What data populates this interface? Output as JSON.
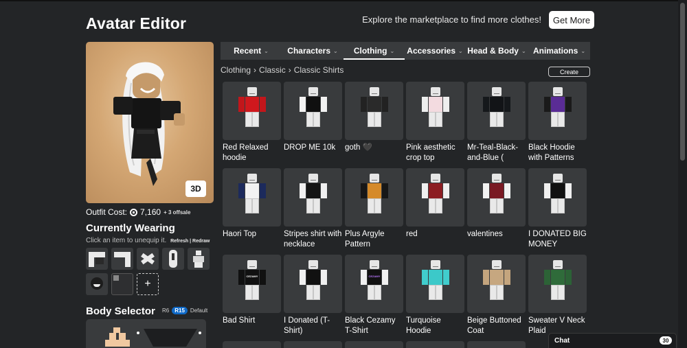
{
  "header": {
    "title": "Avatar Editor",
    "promo_text": "Explore the marketplace to find more clothes!",
    "get_more_label": "Get More"
  },
  "preview": {
    "toggle_3d_label": "3D"
  },
  "outfit": {
    "label": "Outfit Cost:",
    "cost": "7,160",
    "offsale": "+ 3 offsale"
  },
  "currently_wearing": {
    "title": "Currently Wearing",
    "hint": "Click an item to unequip it.",
    "refresh_label": "Refresh",
    "separator": "|",
    "redraw_label": "Redraw",
    "add_label": "+"
  },
  "body_selector": {
    "title": "Body Selector",
    "r6_label": "R6",
    "r15_label": "R15",
    "default_label": "Default"
  },
  "tabs": [
    {
      "label": "Recent",
      "active": false
    },
    {
      "label": "Characters",
      "active": false
    },
    {
      "label": "Clothing",
      "active": true
    },
    {
      "label": "Accessories",
      "active": false
    },
    {
      "label": "Head & Body",
      "active": false
    },
    {
      "label": "Animations",
      "active": false
    }
  ],
  "breadcrumb": [
    "Clothing",
    "Classic",
    "Classic Shirts"
  ],
  "create_label": "Create",
  "items": [
    {
      "name": "Red Relaxed hoodie",
      "torso": "#d0181d",
      "arm": "#c2161b",
      "print": "",
      "print_color": "#fff"
    },
    {
      "name": "DROP ME 10k",
      "torso": "#101010",
      "arm": "#f2f2f2",
      "print": "",
      "print_color": "#fff"
    },
    {
      "name": "goth 🖤",
      "torso": "#2a2a2a",
      "arm": "#222222",
      "print": "",
      "print_color": "#fff"
    },
    {
      "name": "Pink aesthetic crop top",
      "torso": "#f3dbe0",
      "arm": "#eeeeee",
      "print": "",
      "print_color": "#c88"
    },
    {
      "name": "Mr-Teal-Black-and-Blue (",
      "torso": "#121417",
      "arm": "#15181b",
      "print": "",
      "print_color": "#3cd"
    },
    {
      "name": "Black Hoodie with Patterns",
      "torso": "#5a2c95",
      "arm": "#1a1a1a",
      "print": "",
      "print_color": "#fff"
    },
    {
      "name": "Haori Top",
      "torso": "#f2f2f2",
      "arm": "#1c2a5c",
      "print": "",
      "print_color": "#fff"
    },
    {
      "name": "Stripes shirt with necklace",
      "torso": "#151515",
      "arm": "#f0f0f0",
      "print": "",
      "print_color": "#fff"
    },
    {
      "name": "Plus Argyle Pattern",
      "torso": "#d58a2a",
      "arm": "#171717",
      "print": "",
      "print_color": "#fff"
    },
    {
      "name": "red",
      "torso": "#8c1d22",
      "arm": "#efefef",
      "print": "",
      "print_color": "#fff"
    },
    {
      "name": "valentines",
      "torso": "#7a1a24",
      "arm": "#f2f2f2",
      "print": "",
      "print_color": "#fff"
    },
    {
      "name": "I DONATED BIG MONEY",
      "torso": "#111111",
      "arm": "#f0f0f0",
      "print": "",
      "print_color": "#4c4"
    },
    {
      "name": "Bad Shirt",
      "torso": "#111111",
      "arm": "#111111",
      "print": "CEZAMY",
      "print_color": "#fff"
    },
    {
      "name": "I Donated (T-Shirt)",
      "torso": "#111111",
      "arm": "#f0f0f0",
      "print": "",
      "print_color": "#4c4"
    },
    {
      "name": "Black Cezamy T-Shirt",
      "torso": "#111111",
      "arm": "#f0f0f0",
      "print": "CEZAMY",
      "print_color": "#b7f"
    },
    {
      "name": "Turquoise Hoodie",
      "torso": "#3cc9c9",
      "arm": "#41cdcd",
      "print": "",
      "print_color": "#fff"
    },
    {
      "name": "Beige Buttoned Coat",
      "torso": "#c6a780",
      "arm": "#c4a57e",
      "print": "",
      "print_color": "#fff"
    },
    {
      "name": "Sweater V Neck Plaid",
      "torso": "#2f6b3a",
      "arm": "#2c6236",
      "print": "",
      "print_color": "#fff"
    }
  ],
  "chat": {
    "label": "Chat",
    "count": "30"
  }
}
